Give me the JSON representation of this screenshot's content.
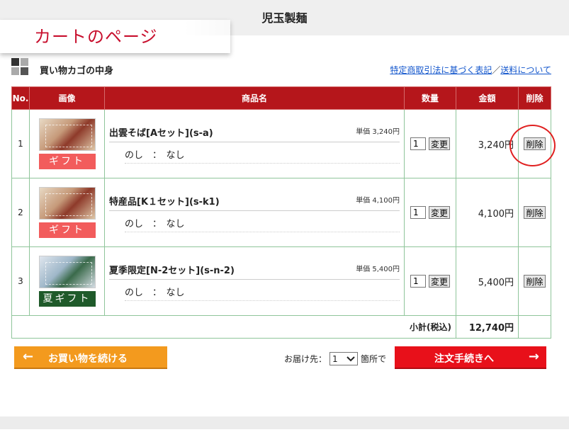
{
  "site": {
    "title": "児玉製麺",
    "page_label": "カートのページ"
  },
  "section": {
    "title": "買い物カゴの中身",
    "link1": "特定商取引法に基づく表記",
    "separator": "／",
    "link2": "送料について"
  },
  "table": {
    "headers": {
      "no": "No.",
      "image": "画像",
      "name": "商品名",
      "qty": "数量",
      "amount": "金額",
      "delete": "削除"
    },
    "rows": [
      {
        "no": "1",
        "gift_label": "ギフト",
        "name": "出雲そば[Aセット](s-a)",
        "unit_price": "単価 3,240円",
        "noshi": "のし　：　なし",
        "qty": "1",
        "update_label": "変更",
        "amount": "3,240円",
        "delete_label": "削除"
      },
      {
        "no": "2",
        "gift_label": "ギフト",
        "name": "特産品[K１セット](s-k1)",
        "unit_price": "単価 4,100円",
        "noshi": "のし　：　なし",
        "qty": "1",
        "update_label": "変更",
        "amount": "4,100円",
        "delete_label": "削除"
      },
      {
        "no": "3",
        "gift_label": "夏ギフト",
        "name": "夏季限定[N-2セット](s-n-2)",
        "unit_price": "単価 5,400円",
        "noshi": "のし　：　なし",
        "qty": "1",
        "update_label": "変更",
        "amount": "5,400円",
        "delete_label": "削除"
      }
    ],
    "subtotal_label": "小計(税込)",
    "subtotal_value": "12,740円"
  },
  "actions": {
    "continue_label": "お買い物を続ける",
    "continue_arrow": "←",
    "dest_label": "お届け先：",
    "dest_value": "1",
    "dest_suffix": "箇所で",
    "checkout_label": "注文手続きへ",
    "checkout_arrow": "→"
  },
  "colors": {
    "header_red": "#b5161b",
    "checkout_red": "#e8101a",
    "continue_orange": "#f39a1e",
    "gift_pink": "#f25c5c",
    "summer_green": "#1f5a2a"
  }
}
